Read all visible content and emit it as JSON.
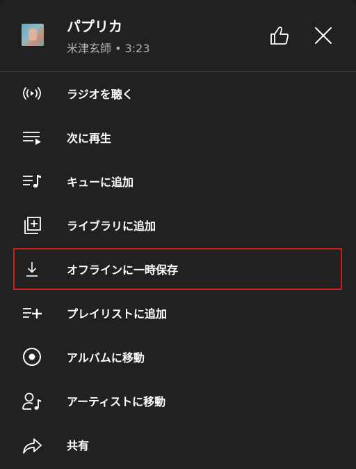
{
  "song": {
    "title": "パプリカ",
    "subtitle": "米津玄師 • 3:23"
  },
  "header_icons": {
    "like": "thumbs-up-icon",
    "close": "close-icon"
  },
  "menu": [
    {
      "label": "ラジオを聴く",
      "icon": "radio-icon"
    },
    {
      "label": "次に再生",
      "icon": "play-next-icon"
    },
    {
      "label": "キューに追加",
      "icon": "add-to-queue-icon"
    },
    {
      "label": "ライブラリに追加",
      "icon": "library-add-icon"
    },
    {
      "label": "オフラインに一時保存",
      "icon": "download-icon"
    },
    {
      "label": "プレイリストに追加",
      "icon": "playlist-add-icon"
    },
    {
      "label": "アルバムに移動",
      "icon": "album-icon"
    },
    {
      "label": "アーティストに移動",
      "icon": "artist-icon"
    },
    {
      "label": "共有",
      "icon": "share-icon"
    }
  ],
  "colors": {
    "background": "#212121",
    "text": "#ffffff",
    "subtext": "#b3b3b3",
    "highlight_border": "#cc1f1f"
  }
}
